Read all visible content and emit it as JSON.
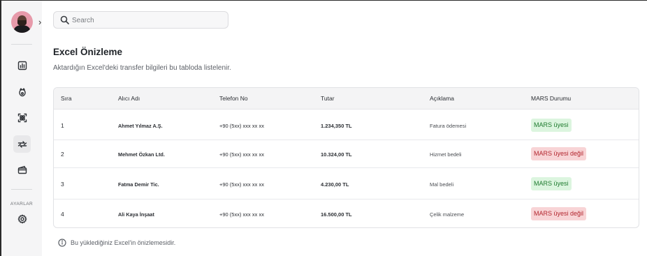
{
  "search": {
    "placeholder": "Search"
  },
  "header": {
    "title": "Excel Önizleme",
    "subtitle": "Aktardığın Excel'deki transfer bilgileri bu tabloda listelenir."
  },
  "sidebar": {
    "icons": [
      "chart-icon",
      "piggy-bank-icon",
      "qr-scan-icon",
      "transfer-icon",
      "wallet-icon"
    ],
    "settings_label": "AYARLAR"
  },
  "table": {
    "headers": [
      "Sıra",
      "Alıcı Adı",
      "Telefon No",
      "Tutar",
      "Açıklama",
      "MARS Durumu"
    ],
    "rows": [
      {
        "index": "1",
        "name": "Ahmet Yılmaz A.Ş.",
        "phone": "+90 (5xx) xxx xx xx",
        "amount": "1.234,350 TL",
        "description": "Fatura ödemesi",
        "status": "MARS üyesi",
        "status_type": "ok"
      },
      {
        "index": "2",
        "name": "Mehmet Özkan Ltd.",
        "phone": "+90 (5xx) xxx xx xx",
        "amount": "10.324,00 TL",
        "description": "Hizmet bedeli",
        "status": "MARS üyesi değil",
        "status_type": "no"
      },
      {
        "index": "3",
        "name": "Fatma Demir Tic.",
        "phone": "+90 (5xx) xxx xx xx",
        "amount": "4.230,00 TL",
        "description": "Mal bedeli",
        "status": "MARS üyesi",
        "status_type": "ok"
      },
      {
        "index": "4",
        "name": "Ali Kaya İnşaat",
        "phone": "+90 (5xx) xxx xx xx",
        "amount": "16.500,00 TL",
        "description": "Çelik malzeme",
        "status": "MARS üyesi değil",
        "status_type": "no"
      }
    ]
  },
  "footer": {
    "note": "Bu yüklediğiniz Excel'in önizlemesidir."
  },
  "colors": {
    "success_bg": "#dcf5df",
    "success_text": "#1e7a2e",
    "danger_bg": "#f8d4d6",
    "danger_text": "#b3262f",
    "sidebar_bg": "#f5f5f6"
  }
}
